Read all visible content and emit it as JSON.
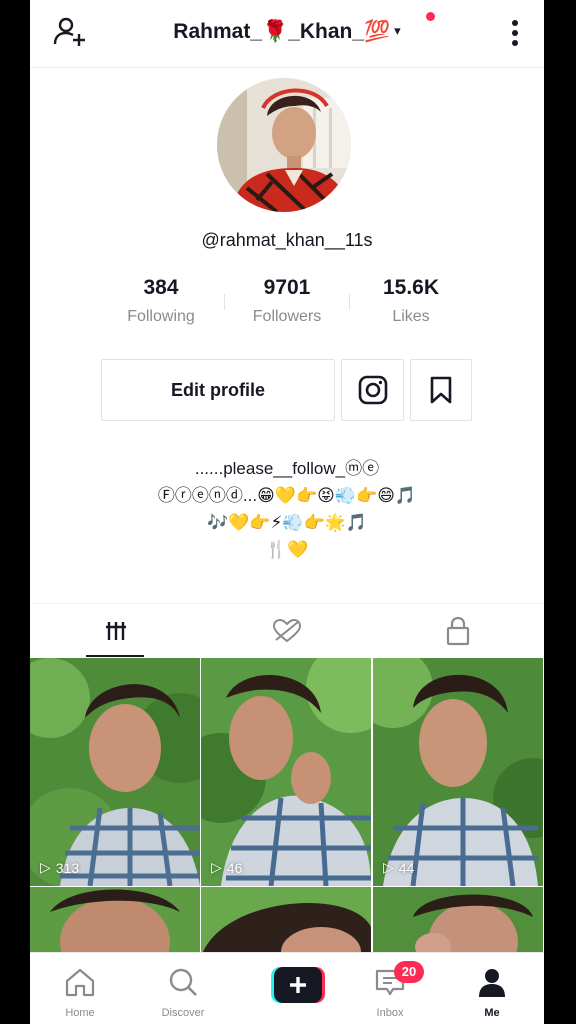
{
  "header": {
    "username_title": "Rahmat_🌹_Khan_💯",
    "caret": "▾",
    "add_user_icon": "add-user-icon",
    "more_icon": "more-vertical-icon",
    "notification_dot_color": "#fe2c55"
  },
  "profile": {
    "handle": "@rahmat_khan__11s",
    "stats": [
      {
        "value": "384",
        "label": "Following"
      },
      {
        "value": "9701",
        "label": "Followers"
      },
      {
        "value": "15.6K",
        "label": "Likes"
      }
    ],
    "edit_profile_label": "Edit profile",
    "bio_lines": [
      "......please__follow_ⓜⓔ",
      "Ⓕⓡⓔⓝⓓ...😁💛👉😝💨👉😄🎵",
      "🎶💛👉⚡💨👉🌟🎵",
      "🍴💛"
    ]
  },
  "tabs": [
    {
      "name": "videos",
      "icon": "grid-icon",
      "active": true
    },
    {
      "name": "liked",
      "icon": "liked-hidden-icon",
      "active": false
    },
    {
      "name": "private",
      "icon": "lock-icon",
      "active": false
    }
  ],
  "videos": [
    {
      "views": "313"
    },
    {
      "views": "46"
    },
    {
      "views": "44"
    },
    {
      "views": ""
    },
    {
      "views": ""
    },
    {
      "views": ""
    }
  ],
  "nav": {
    "home": "Home",
    "discover": "Discover",
    "inbox": "Inbox",
    "me": "Me",
    "inbox_badge": "20",
    "accent_red": "#fe2c55",
    "accent_cyan": "#25f4ee"
  }
}
